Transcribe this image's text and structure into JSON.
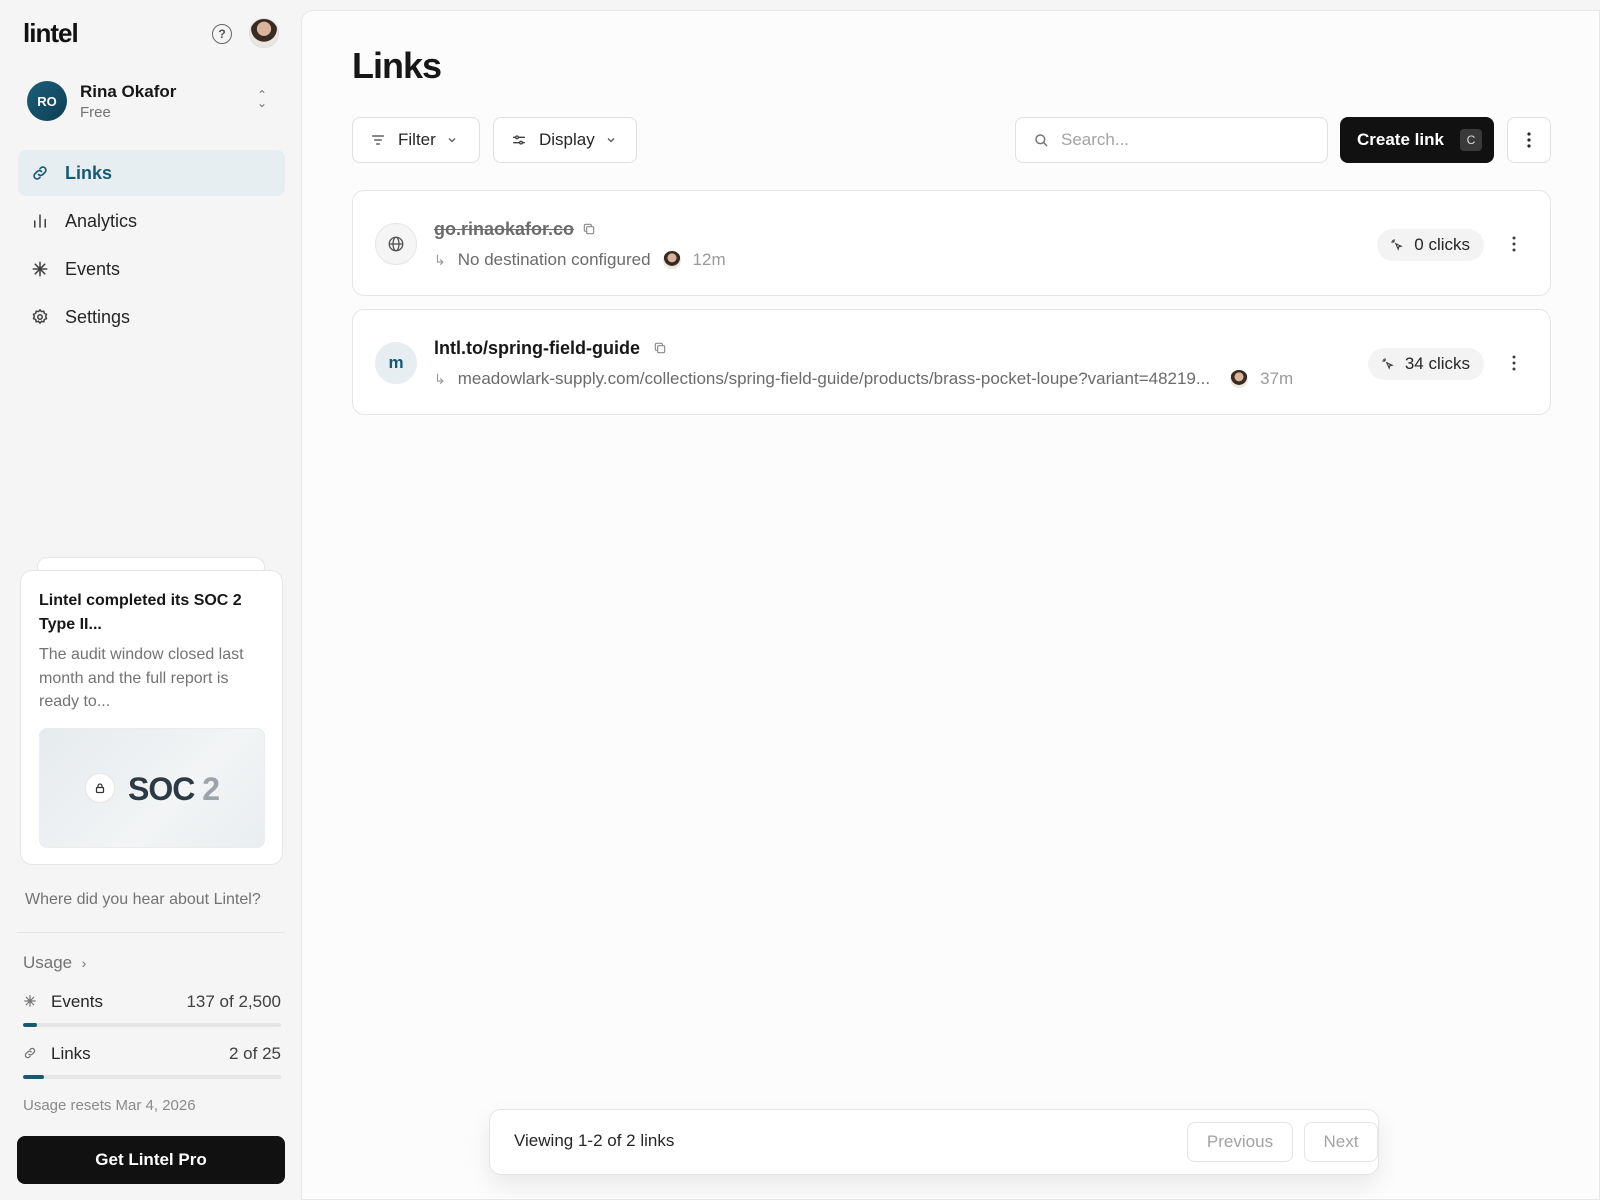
{
  "app": {
    "logo_text": "lintel",
    "help_icon": "question-circle-icon"
  },
  "account": {
    "initials": "RO",
    "name": "Rina Okafor",
    "plan": "Free",
    "avatar_color": "#185a72"
  },
  "nav": [
    {
      "label": "Links",
      "icon": "link-icon",
      "active": true
    },
    {
      "label": "Analytics",
      "icon": "bar-chart-icon",
      "active": false
    },
    {
      "label": "Events",
      "icon": "sparkle-icon",
      "active": false
    },
    {
      "label": "Settings",
      "icon": "gear-icon",
      "active": false
    }
  ],
  "announcement": {
    "title": "Lintel completed its SOC 2 Type II...",
    "body": "The audit window closed last month and the full report is ready to...",
    "image_text": "SOC",
    "image_text_suffix": "2"
  },
  "feedback_prompt": "Where did you hear about Lintel?",
  "usage": {
    "heading": "Usage",
    "rows": [
      {
        "label": "Events",
        "value_text": "137 of 2,500",
        "used": 137,
        "limit": 2500,
        "icon": "sparkle-icon"
      },
      {
        "label": "Links",
        "value_text": "2 of 25",
        "used": 2,
        "limit": 25,
        "icon": "link-icon"
      }
    ],
    "resets": "Usage resets Mar 4, 2026"
  },
  "upgrade_button": "Get Lintel Pro",
  "main": {
    "title": "Links",
    "filter_label": "Filter",
    "display_label": "Display",
    "search_placeholder": "Search...",
    "create_label": "Create link",
    "create_shortcut": "C"
  },
  "links": [
    {
      "short_url": "go.rinaokafor.co",
      "disabled": true,
      "favicon": "globe-icon",
      "destination": "No destination configured",
      "age": "12m",
      "clicks": "0 clicks"
    },
    {
      "short_url": "lntl.to/spring-field-guide",
      "disabled": false,
      "favicon_letter": "m",
      "destination": "meadowlark-supply.com/collections/spring-field-guide/products/brass-pocket-loupe?variant=48219...",
      "age": "37m",
      "clicks": "34 clicks"
    }
  ],
  "pagination": {
    "summary": "Viewing 1-2 of 2 links",
    "previous": "Previous",
    "next": "Next"
  },
  "colors": {
    "accent": "#185a72",
    "primary_button": "#111111",
    "active_nav_bg": "#e6eef1"
  }
}
